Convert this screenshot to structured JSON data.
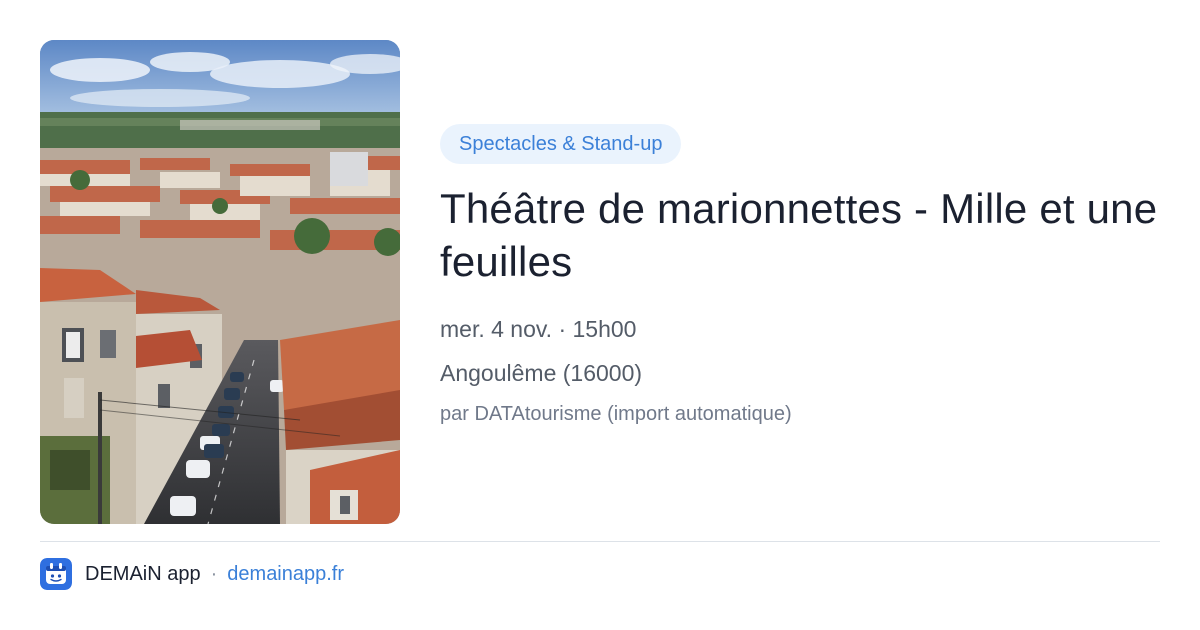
{
  "event": {
    "category": "Spectacles & Stand-up",
    "title": "Théâtre de marionnettes - Mille et une feuilles",
    "date_time": "mer. 4 nov. · 15h00",
    "location": "Angoulême (16000)",
    "source": "par DATAtourisme (import automatique)"
  },
  "image": {
    "subject": "aerial view of old town street with terracotta rooftops"
  },
  "footer": {
    "app_name": "DEMAiN app",
    "separator": "·",
    "url": "demainapp.fr",
    "icon": "demain-app-icon"
  },
  "colors": {
    "accent": "#3b80d8",
    "badge_background": "#eaf3fd",
    "title_text": "#1b2130",
    "muted_text": "#545c68",
    "divider": "#dde2e8"
  }
}
